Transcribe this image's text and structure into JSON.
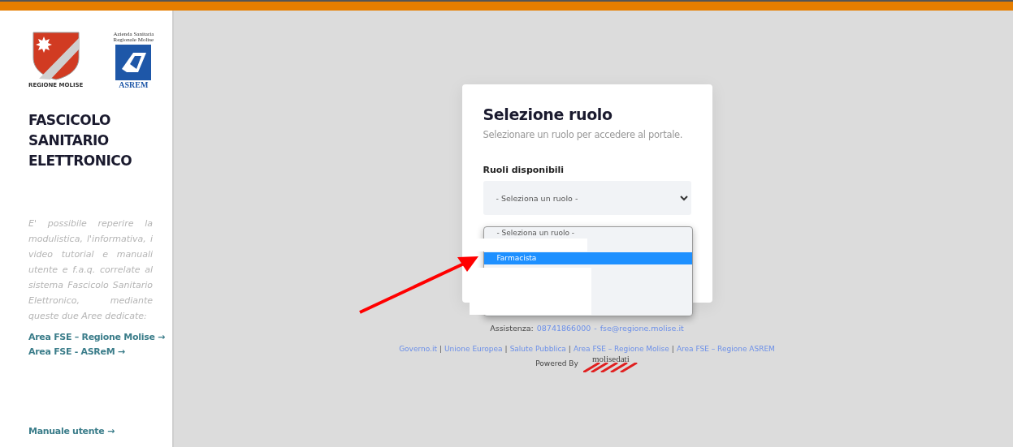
{
  "sidebar": {
    "logo_left_caption": "REGIONE MOLISE",
    "logo_right_caption": "Azienda Sanitaria Regionale Molise",
    "logo_right_name": "ASREM",
    "title_lines": [
      "FASCICOLO",
      "SANITARIO",
      "ELETTRONICO"
    ],
    "description": "E' possibile reperire la modulistica, l'informativa, i video tutorial e manuali utente e f.a.q. correlate al sistema Fascicolo Sanitario Elettronico, mediante queste due Aree dedicate:",
    "links": [
      "Area FSE – Regione Molise →",
      "Area FSE - ASReM →"
    ],
    "bottom_link": "Manuale utente →"
  },
  "card": {
    "title": "Selezione ruolo",
    "subtitle": "Selezionare un ruolo per accedere al portale.",
    "field_label": "Ruoli disponibili",
    "select_value": "- Seleziona un ruolo -",
    "options": [
      {
        "label": "- Seleziona un ruolo -",
        "selected": false
      },
      {
        "selected": false
      },
      {
        "label": "Farmacista",
        "selected": true
      }
    ]
  },
  "footer": {
    "assist_label": "Assistenza:",
    "phone": "08741866000",
    "separator": "-",
    "email": "fse@regione.molise.it",
    "link_separator": "|",
    "links": [
      "Governo.it",
      "Unione Europea",
      "Salute Pubblica",
      "Area FSE – Regione Molise",
      "Area FSE – Regione ASREM"
    ],
    "powered_by": "Powered By",
    "brand": "molisedati"
  }
}
